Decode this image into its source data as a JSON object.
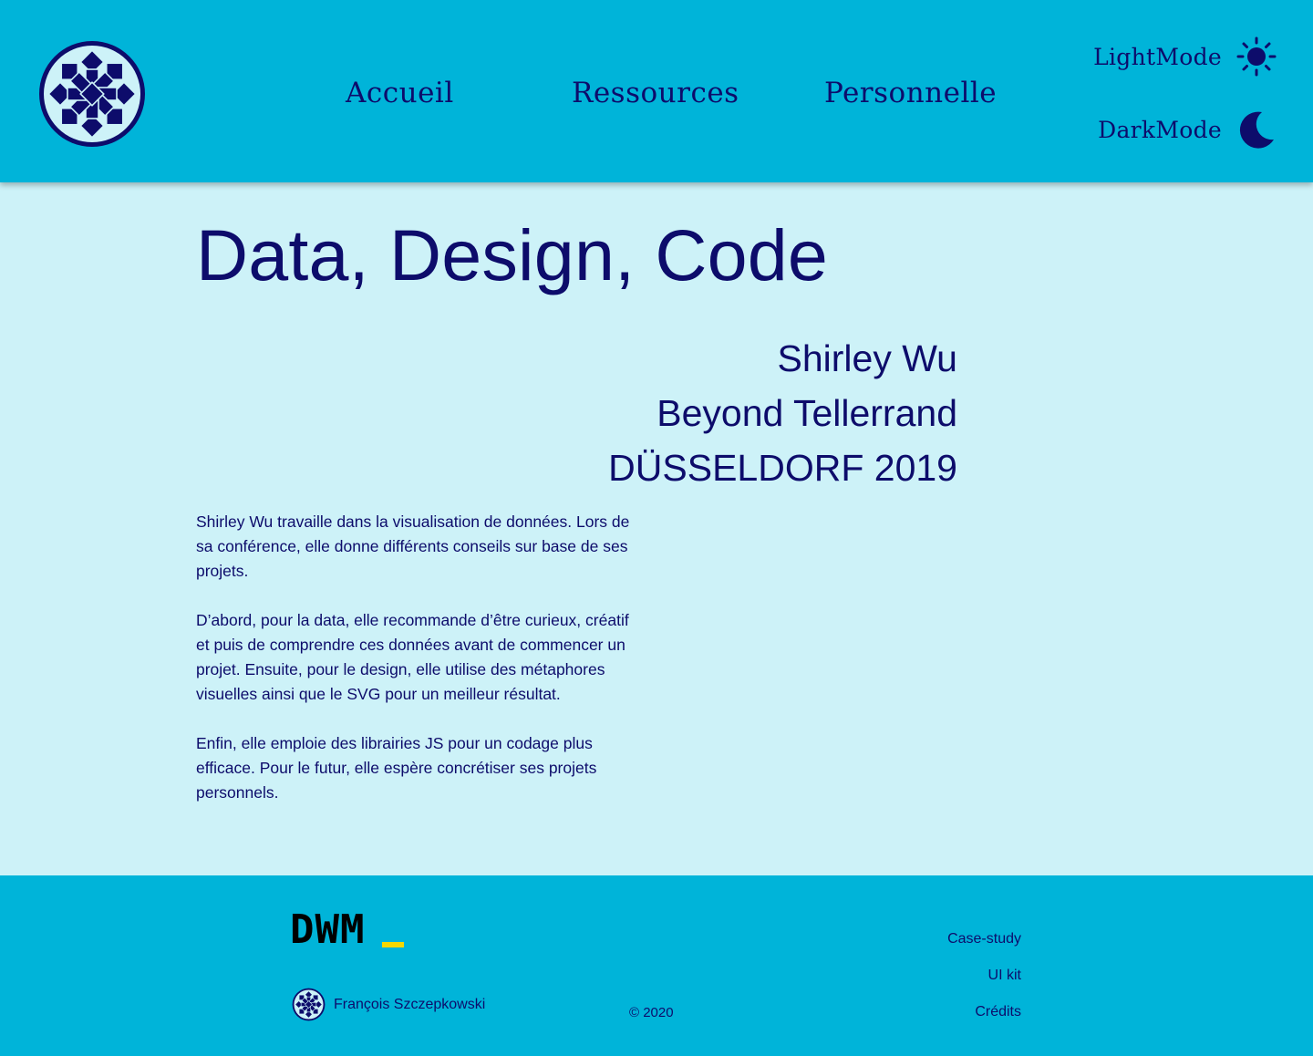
{
  "header": {
    "logo": {
      "icon": "snowflake-logo-icon"
    },
    "nav": [
      {
        "label": "Accueil"
      },
      {
        "label": "Ressources"
      },
      {
        "label": "Personnelle"
      }
    ],
    "modes": {
      "light": {
        "label": "LightMode",
        "icon": "sun-icon"
      },
      "dark": {
        "label": "DarkMode",
        "icon": "moon-icon"
      }
    }
  },
  "main": {
    "title": "Data, Design, Code",
    "speaker": "Shirley Wu",
    "event": "Beyond Tellerrand",
    "location": "DÜSSELDORF 2019",
    "paragraphs": [
      "Shirley Wu travaille dans la visualisation de données. Lors de sa conférence, elle donne différents conseils sur base de ses projets.",
      "D’abord, pour la data, elle recommande d’être curieux, créatif et puis de comprendre ces données avant de commencer un projet. Ensuite, pour le design, elle utilise des métaphores visuelles ainsi que le SVG pour un meilleur résultat.",
      "Enfin, elle emploie des librairies JS pour un codage plus efficace. Pour le futur, elle espère concrétiser ses projets personnels."
    ]
  },
  "footer": {
    "brand": "DWM",
    "author": "François Szczepkowski",
    "copyright": "© 2020",
    "links": [
      {
        "label": "Case-study"
      },
      {
        "label": "UI kit"
      },
      {
        "label": "Crédits"
      }
    ]
  },
  "colors": {
    "header_bg": "#00b4d9",
    "page_bg": "#cdf2f8",
    "text": "#0d0c6b",
    "cursor_accent": "#f5d800"
  }
}
